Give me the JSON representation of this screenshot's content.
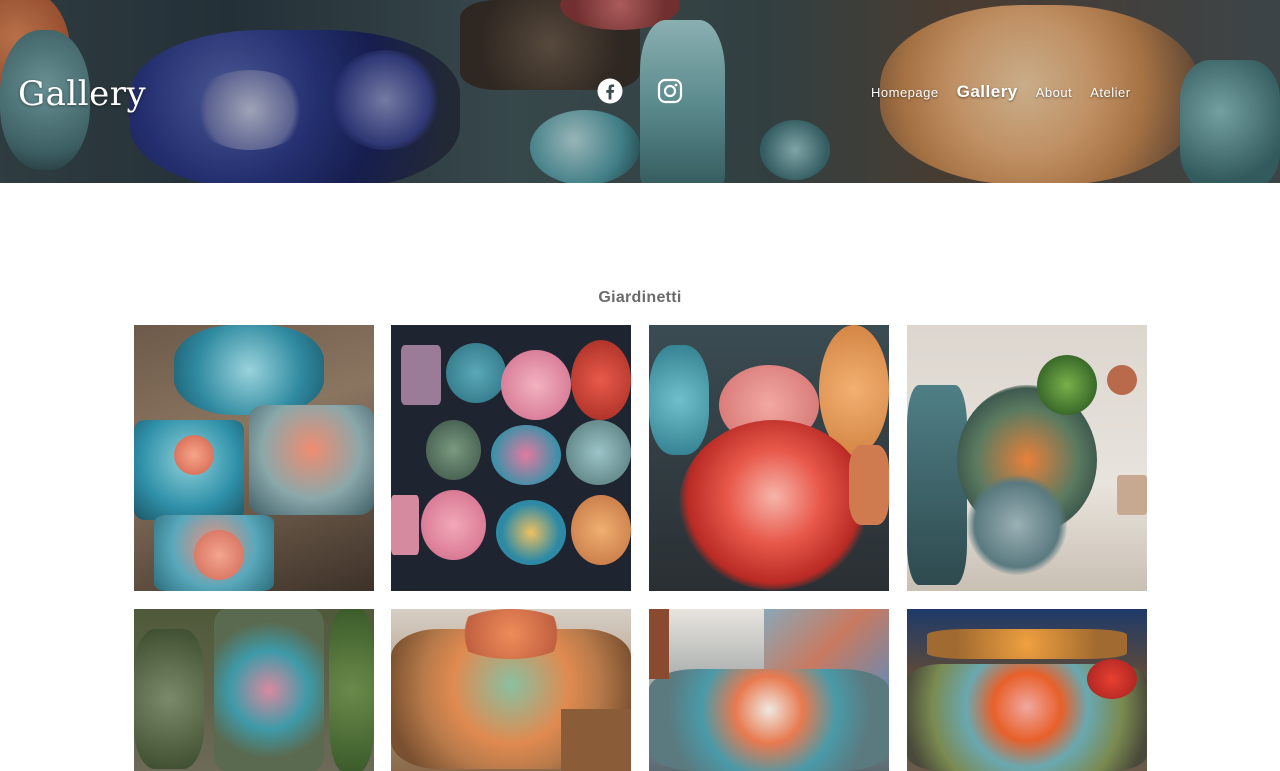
{
  "header": {
    "site_title": "Gallery",
    "social": [
      {
        "name": "facebook-icon"
      },
      {
        "name": "instagram-icon"
      }
    ],
    "nav": [
      {
        "label": "Homepage",
        "active": false
      },
      {
        "label": "Gallery",
        "active": true
      },
      {
        "label": "About",
        "active": false
      },
      {
        "label": "Atelier",
        "active": false
      }
    ]
  },
  "main": {
    "section_title": "Giardinetti",
    "tiles": [
      {
        "subject": "ceramic-leaf-and-tiles"
      },
      {
        "subject": "ceramic-tile-grid"
      },
      {
        "subject": "red-spiky-ceramic"
      },
      {
        "subject": "ceramic-shelf-display"
      },
      {
        "subject": "ceramic-garden-outdoor"
      },
      {
        "subject": "ceramic-drawer-garden"
      },
      {
        "subject": "ceramic-cluster-colorful"
      },
      {
        "subject": "ceramic-table-display"
      }
    ]
  },
  "colors": {
    "nav_text": "#ffffff",
    "section_title": "#6b6b6b",
    "background": "#ffffff"
  }
}
